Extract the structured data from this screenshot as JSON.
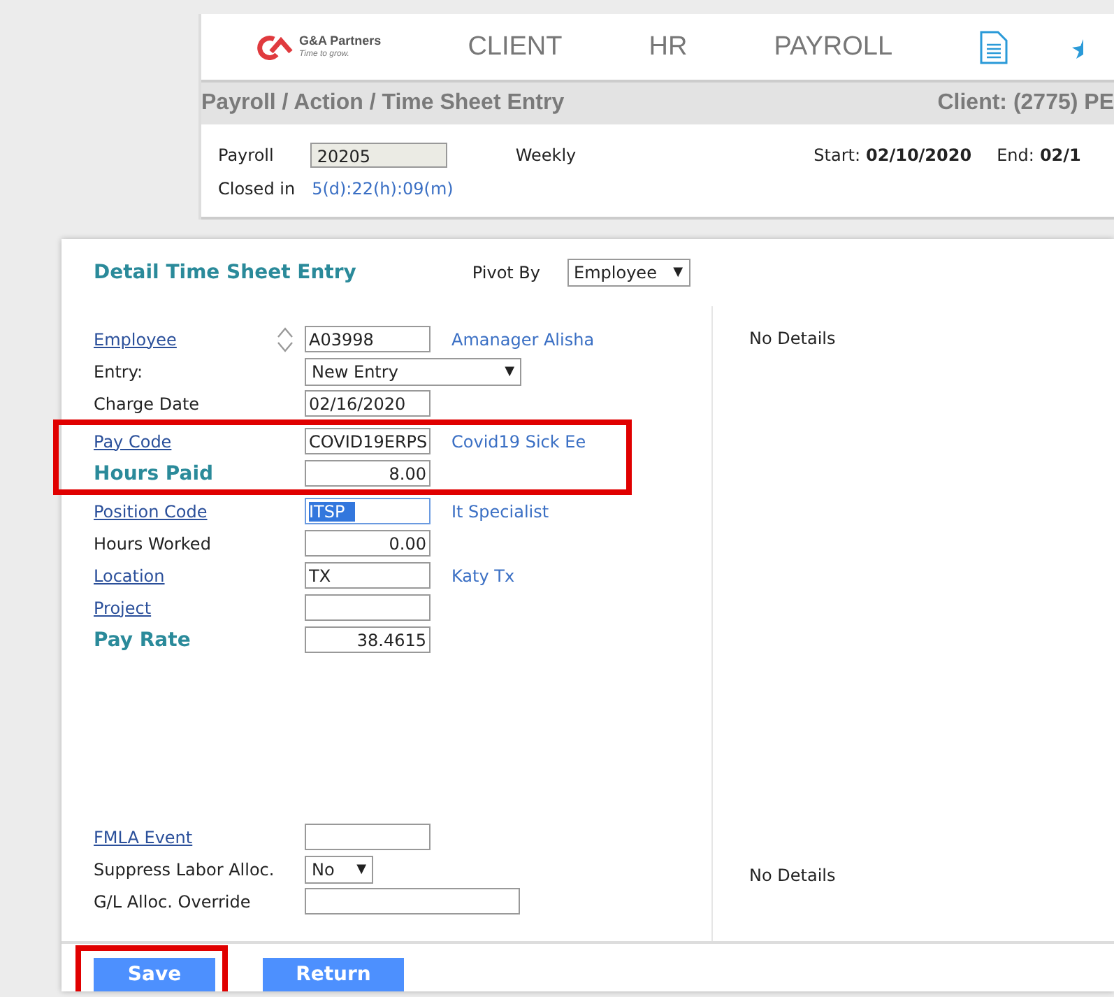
{
  "logo": {
    "name": "G&A Partners",
    "tagline": "Time to grow."
  },
  "nav": {
    "items": [
      "CLIENT",
      "HR",
      "PAYROLL"
    ]
  },
  "breadcrumb": "Payroll / Action / Time Sheet Entry",
  "client": "Client: (2775) PE",
  "payroll_info": {
    "payroll_label": "Payroll",
    "payroll_value": "20205",
    "frequency": "Weekly",
    "start_label": "Start:",
    "start_value": "02/10/2020",
    "end_label": "End:",
    "end_value": "02/1",
    "closed_label": "Closed in",
    "closed_value": "5(d):22(h):09(m)"
  },
  "detail": {
    "title": "Detail Time Sheet Entry",
    "pivot_label": "Pivot By",
    "pivot_value": "Employee",
    "pivot_caret": "▼",
    "field_groups": [
      {
        "highlighted": false,
        "gap_before": false,
        "fields": [
          {
            "label": {
              "text": "Employee",
              "kind": "link"
            },
            "kind": "text",
            "value": "A03998",
            "description": "Amanager Alisha",
            "spinner": true
          },
          {
            "label": {
              "text": "Entry:",
              "kind": "plain"
            },
            "kind": "select",
            "value": "New Entry",
            "caret": "▼"
          },
          {
            "label": {
              "text": "Charge Date",
              "kind": "plain"
            },
            "kind": "text",
            "value": "02/16/2020"
          }
        ]
      },
      {
        "highlighted": true,
        "gap_before": false,
        "fields": [
          {
            "label": {
              "text": "Pay Code",
              "kind": "link"
            },
            "kind": "text",
            "value": "COVID19ERPS",
            "description": "Covid19 Sick Ee"
          },
          {
            "label": {
              "text": "Hours Paid",
              "kind": "emphasis"
            },
            "kind": "number",
            "value": "8.00"
          }
        ]
      },
      {
        "highlighted": false,
        "gap_before": false,
        "fields": [
          {
            "label": {
              "text": "Position Code",
              "kind": "link"
            },
            "kind": "text",
            "value": "ITSP",
            "description": "It Specialist",
            "text_selected": true
          },
          {
            "label": {
              "text": "Hours Worked",
              "kind": "plain"
            },
            "kind": "number",
            "value": "0.00"
          },
          {
            "label": {
              "text": "Location",
              "kind": "link"
            },
            "kind": "text",
            "value": "TX",
            "description": "Katy Tx"
          },
          {
            "label": {
              "text": "Project",
              "kind": "link"
            },
            "kind": "text"
          },
          {
            "label": {
              "text": "Pay Rate",
              "kind": "emphasis"
            },
            "kind": "number",
            "value": "38.4615"
          }
        ]
      },
      {
        "highlighted": false,
        "gap_before": true,
        "fields": [
          {
            "label": {
              "text": "FMLA Event",
              "kind": "link"
            },
            "kind": "text"
          },
          {
            "label": {
              "text": "Suppress Labor Alloc.",
              "kind": "plain"
            },
            "kind": "flag_select",
            "value": "No",
            "caret": "▼"
          },
          {
            "label": {
              "text": "G/L Alloc. Override",
              "kind": "plain"
            },
            "kind": "long_text"
          }
        ]
      }
    ],
    "details_top": "No Details",
    "details_bottom": "No Details"
  },
  "buttons": [
    {
      "label": "Save",
      "highlighted": true
    },
    {
      "label": "Return",
      "highlighted": false
    }
  ]
}
